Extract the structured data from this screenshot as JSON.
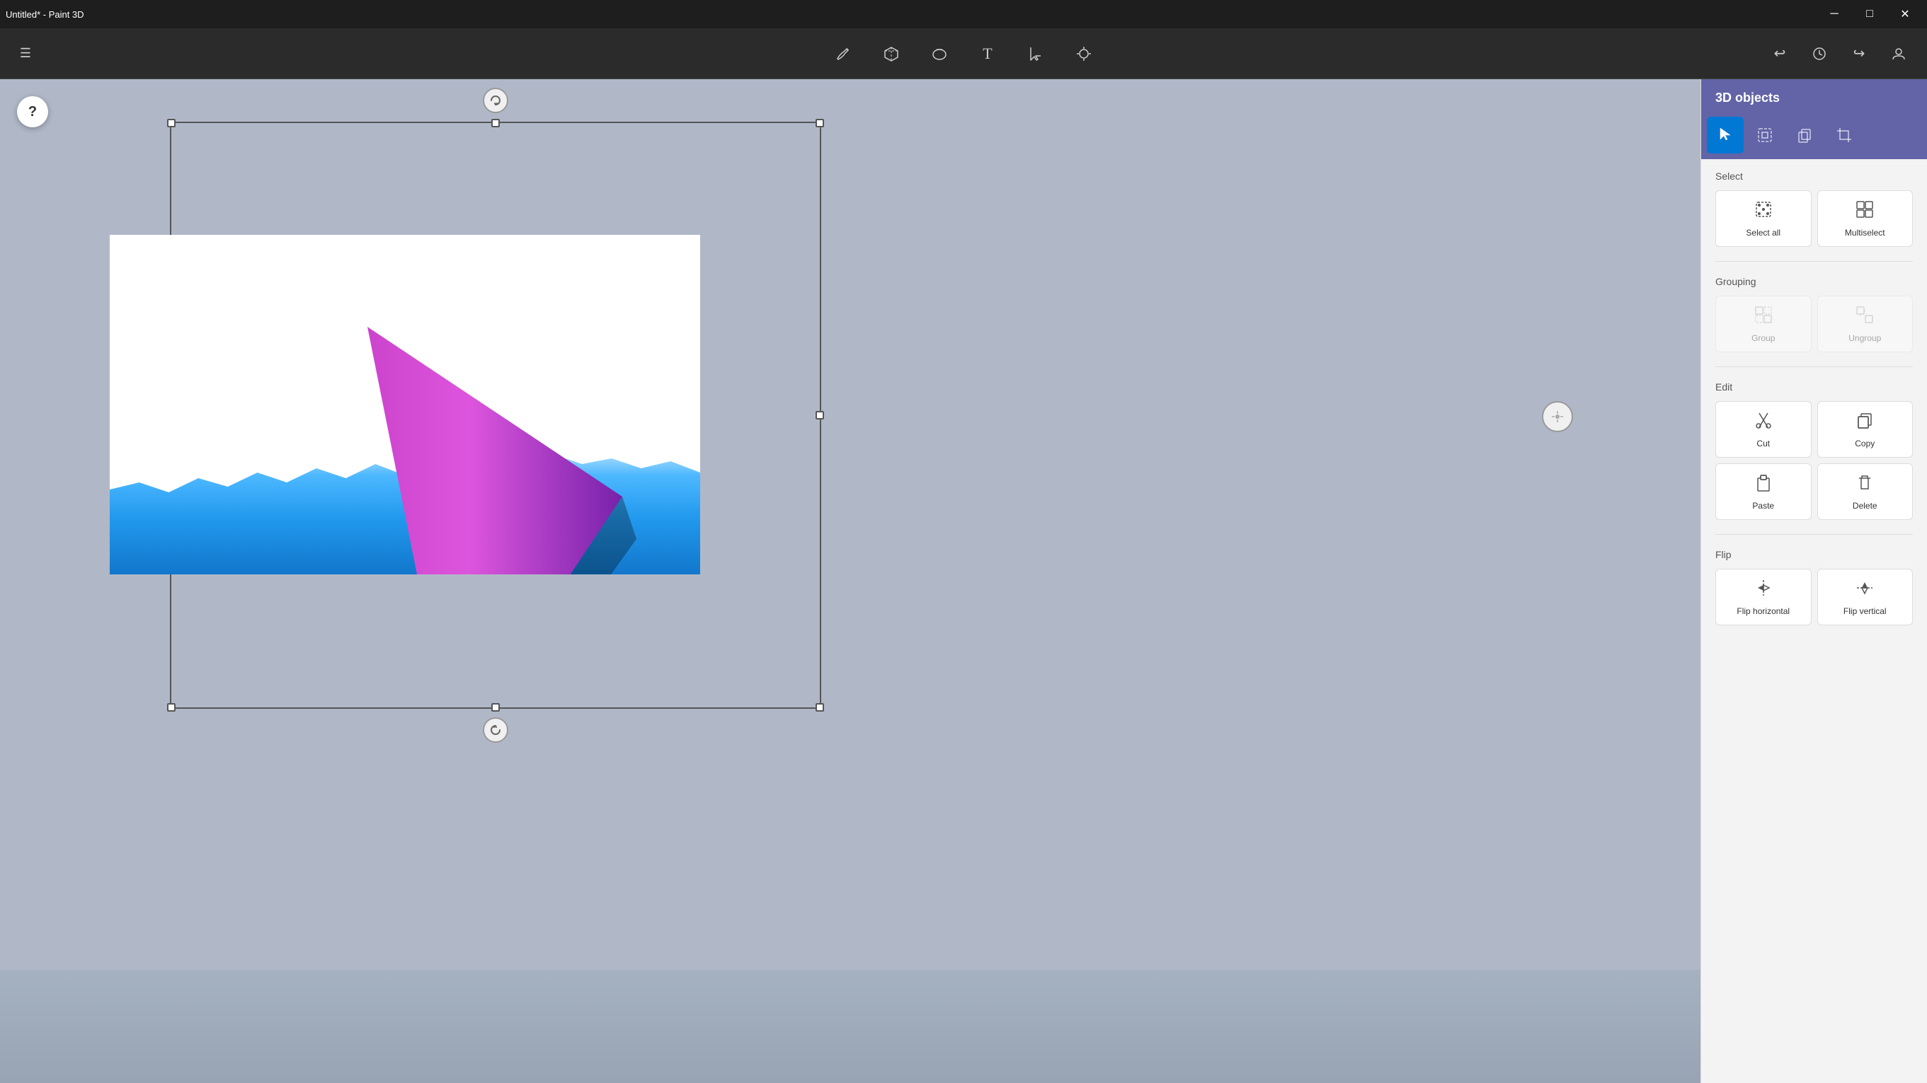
{
  "window": {
    "title": "Untitled* - Paint 3D"
  },
  "titlebar": {
    "minimize": "─",
    "maximize": "□",
    "close": "✕"
  },
  "toolbar": {
    "hamburger": "☰",
    "tools": [
      {
        "name": "brush-tool",
        "icon": "✏️",
        "label": "Brushes"
      },
      {
        "name": "3d-objects-tool",
        "icon": "🔷",
        "label": "3D objects"
      },
      {
        "name": "2d-shapes-tool",
        "icon": "⬭",
        "label": "2D shapes"
      },
      {
        "name": "text-tool",
        "icon": "T",
        "label": "Text"
      },
      {
        "name": "select-tool",
        "icon": "⤢",
        "label": "Select"
      },
      {
        "name": "effects-tool",
        "icon": "✦",
        "label": "Effects"
      }
    ],
    "actions": [
      {
        "name": "undo",
        "icon": "↩"
      },
      {
        "name": "history",
        "icon": "🕐"
      },
      {
        "name": "redo",
        "icon": "↪"
      },
      {
        "name": "profile",
        "icon": "👤"
      }
    ]
  },
  "panel": {
    "title": "3D objects",
    "tabs": [
      {
        "name": "select-tab",
        "icon": "cursor",
        "active": true
      },
      {
        "name": "3d-select-tab",
        "icon": "3d-select"
      },
      {
        "name": "copy-tab",
        "icon": "copy"
      },
      {
        "name": "crop-tab",
        "icon": "crop"
      }
    ],
    "select_section": {
      "title": "Select",
      "select_all": "Select all",
      "multiselect": "Multiselect"
    },
    "grouping_section": {
      "title": "Grouping",
      "group": "Group",
      "ungroup": "Ungroup"
    },
    "edit_section": {
      "title": "Edit",
      "cut": "Cut",
      "copy": "Copy",
      "paste": "Paste",
      "delete": "Delete"
    },
    "flip_section": {
      "title": "Flip",
      "flip_horizontal": "Flip horizontal",
      "flip_vertical": "Flip vertical"
    }
  },
  "help": "?"
}
